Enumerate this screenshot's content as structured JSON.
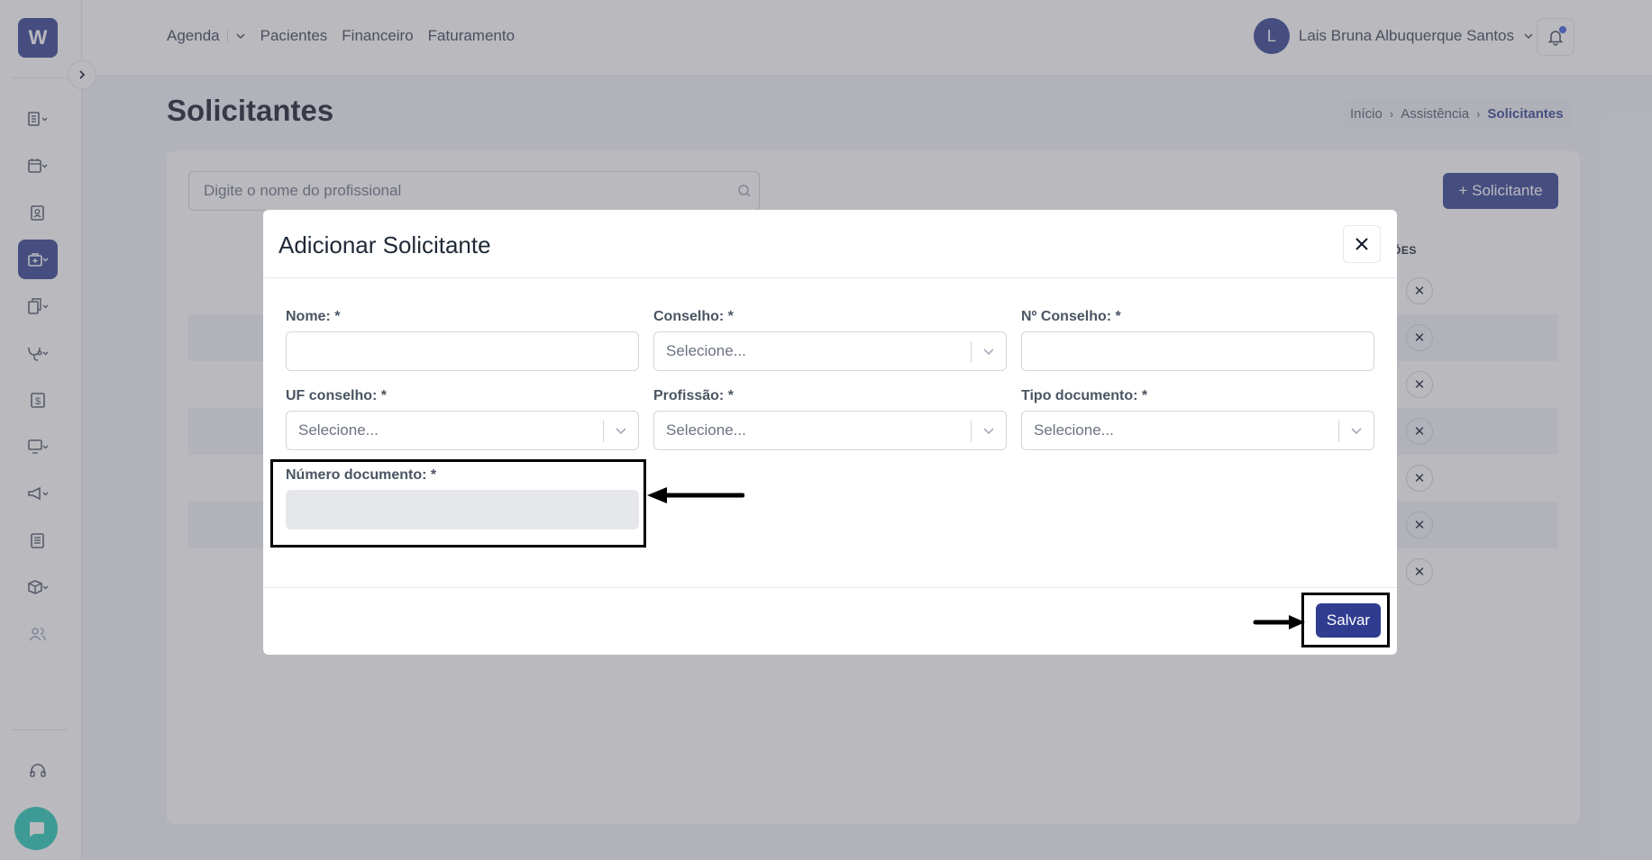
{
  "app": {
    "logo_letter": "W"
  },
  "topnav": {
    "items": [
      "Agenda",
      "Pacientes",
      "Financeiro",
      "Faturamento"
    ],
    "user_initial": "L",
    "user_name": "Lais Bruna Albuquerque Santos"
  },
  "page": {
    "title": "Solicitantes",
    "breadcrumb": [
      "Início",
      "Assistência",
      "Solicitantes"
    ]
  },
  "list": {
    "search_placeholder": "Digite o nome do profissional",
    "add_button": "+ Solicitante",
    "actions_header": "ÕES",
    "row_count": 7
  },
  "modal": {
    "title": "Adicionar Solicitante",
    "fields": {
      "nome": "Nome: *",
      "conselho": "Conselho: *",
      "numero_conselho": "Nº Conselho: *",
      "uf_conselho": "UF conselho: *",
      "profissao": "Profissão: *",
      "tipo_documento": "Tipo documento: *",
      "numero_documento": "Número documento: *"
    },
    "select_placeholder": "Selecione...",
    "save_button": "Salvar"
  },
  "colors": {
    "primary": "#2f3c8f",
    "chat": "#1fc6b4",
    "highlight": "#000000"
  }
}
